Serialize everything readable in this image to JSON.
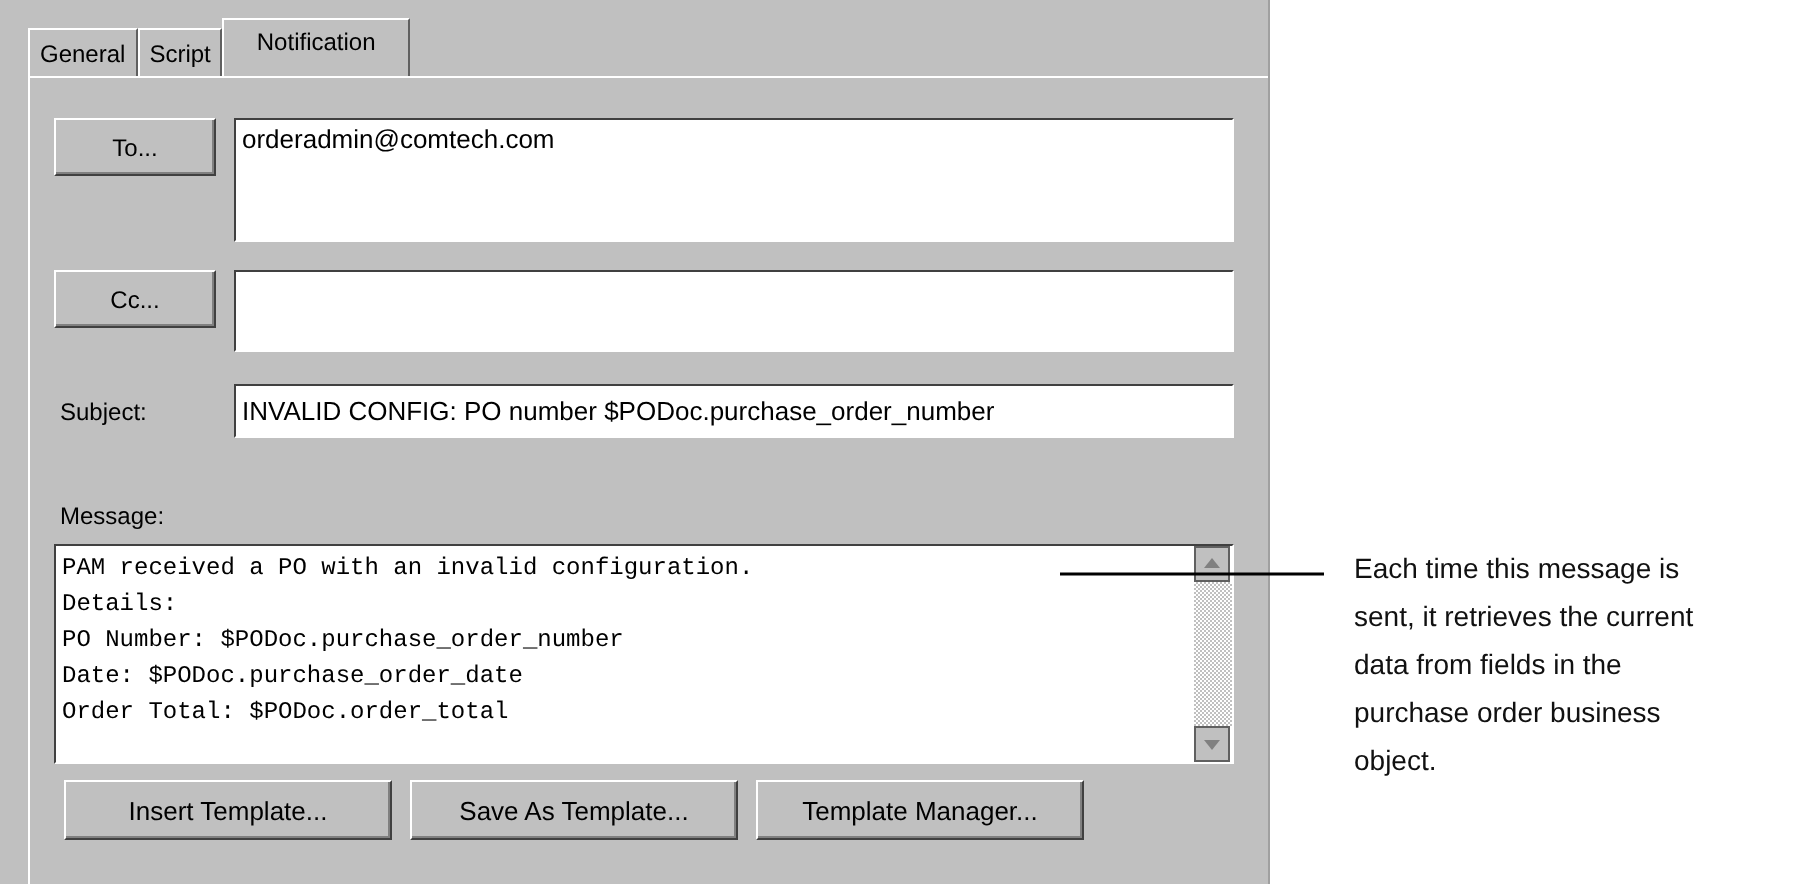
{
  "tabs": [
    {
      "label": "General",
      "selected": false
    },
    {
      "label": "Script",
      "selected": false
    },
    {
      "label": "Notification",
      "selected": true
    }
  ],
  "to": {
    "button": "To...",
    "value": "orderadmin@comtech.com"
  },
  "cc": {
    "button": "Cc..."
  },
  "subject": {
    "label": "Subject:",
    "value": "INVALID CONFIG: PO number $PODoc.purchase_order_number"
  },
  "message": {
    "label": "Message:",
    "lines": [
      "PAM received a PO with an invalid configuration.",
      "Details:",
      "PO Number: $PODoc.purchase_order_number",
      "Date: $PODoc.purchase_order_date",
      "Order Total: $PODoc.order_total"
    ]
  },
  "buttons": [
    "Insert Template...",
    "Save As Template...",
    "Template Manager..."
  ],
  "callout": "Each time this message is sent, it retrieves the current data from fields in the purchase order business object."
}
